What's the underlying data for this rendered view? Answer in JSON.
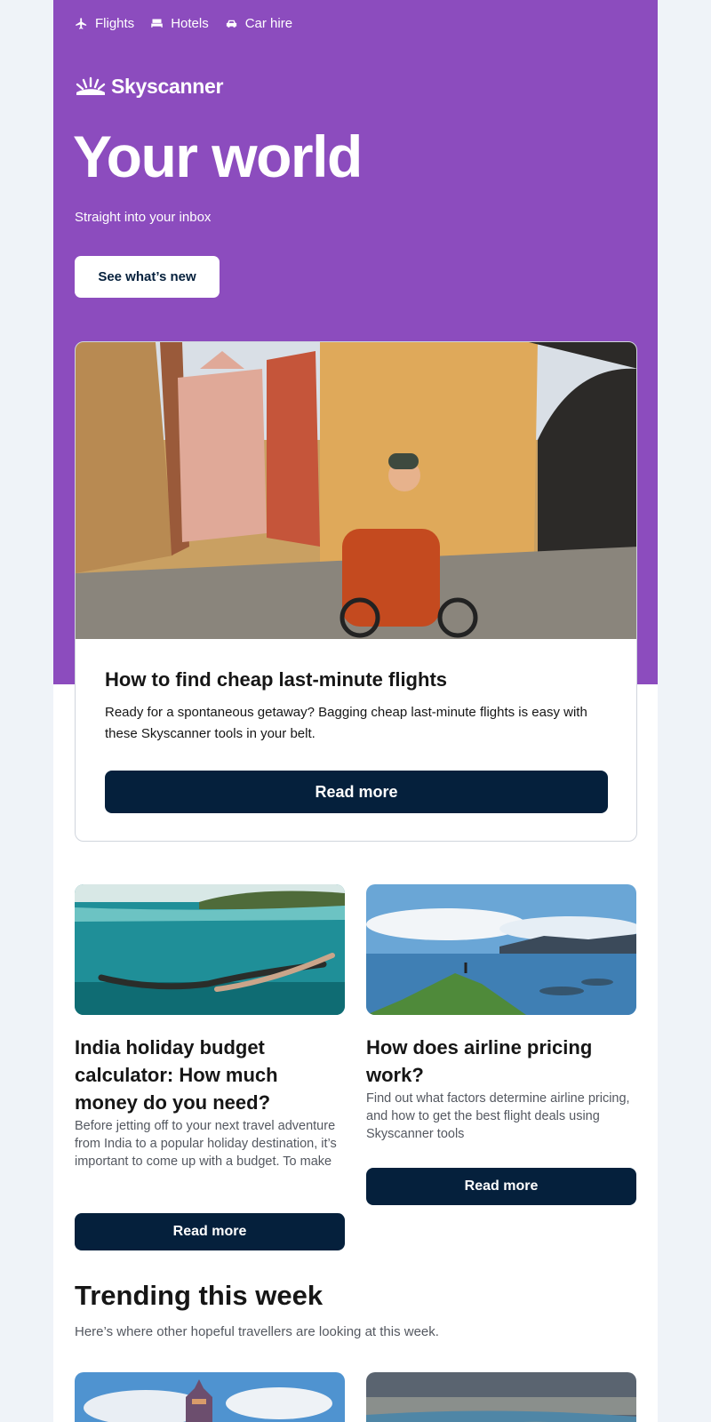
{
  "nav": {
    "items": [
      {
        "label": "Flights",
        "icon": "plane-icon"
      },
      {
        "label": "Hotels",
        "icon": "bed-icon"
      },
      {
        "label": "Car hire",
        "icon": "car-icon"
      }
    ]
  },
  "brand": {
    "name": "Skyscanner",
    "hero_color": "#8c4cbe",
    "button_color": "#05203c"
  },
  "hero": {
    "title": "Your world",
    "subtitle": "Straight into your inbox",
    "button_label": "See what’s new"
  },
  "feature": {
    "title": "How to find cheap last-minute flights",
    "description": "Ready for a spontaneous getaway? Bagging cheap last-minute flights is easy with these Skyscanner tools in your belt.",
    "button_label": "Read more"
  },
  "articles": [
    {
      "title": "India holiday budget calculator: How much money do you need?",
      "description": "Before jetting off to your next travel adventure from India to a popular holiday destination, it’s important to come up with a budget. To make",
      "button_label": "Read more"
    },
    {
      "title": "How does airline pricing work?",
      "description": "Find out what factors determine airline pricing, and how to get the best flight deals using Skyscanner tools",
      "button_label": "Read more"
    }
  ],
  "trending": {
    "title": "Trending this week",
    "subtitle": "Here’s where other hopeful travellers are looking at this week."
  }
}
